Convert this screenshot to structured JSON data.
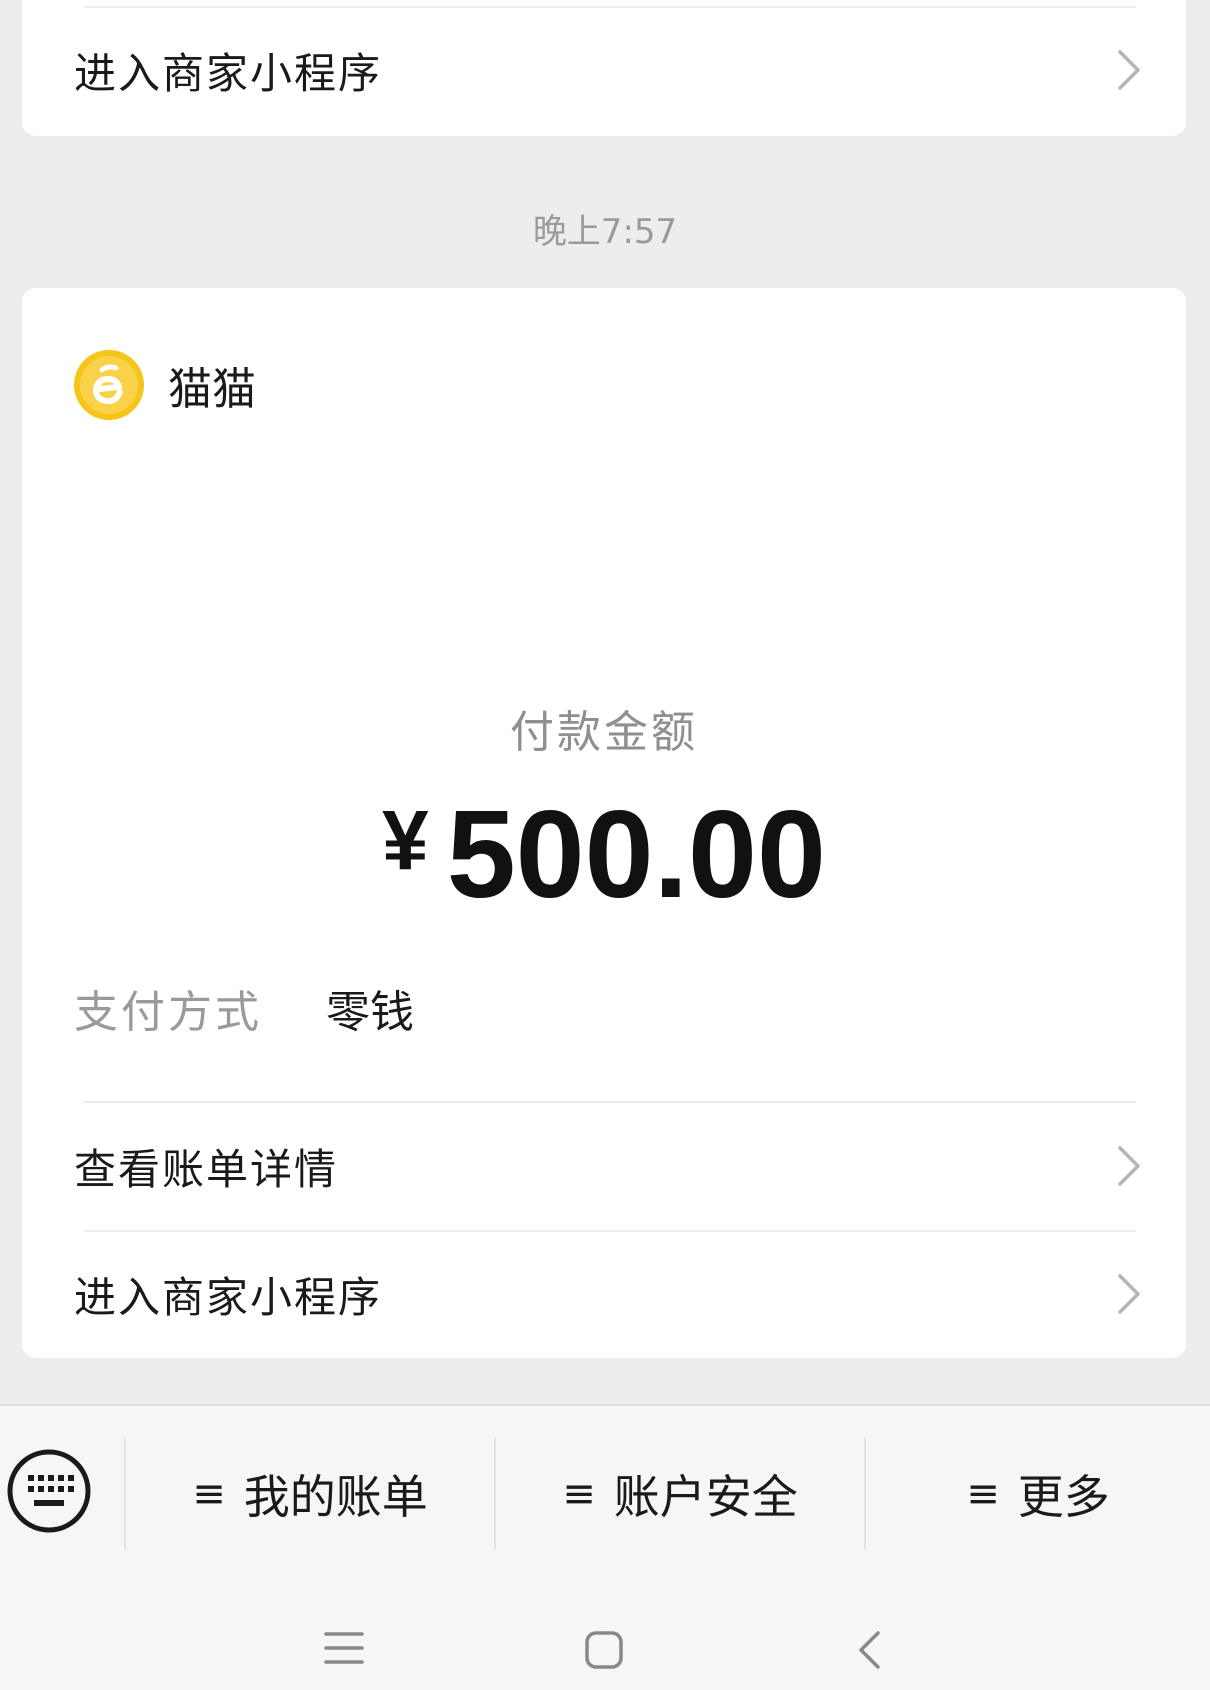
{
  "top_card": {
    "row_label": "进入商家小程序"
  },
  "timestamp": "晚上7:57",
  "merchant": {
    "name": "猫猫",
    "logo_color": "#f5c518",
    "logo_icon": "merchant-logo-icon"
  },
  "payment": {
    "amount_label": "付款金额",
    "currency_symbol": "¥",
    "amount": "500.00",
    "method_label": "支付方式",
    "method_value": "零钱"
  },
  "rows": {
    "bill_details": "查看账单详情",
    "enter_miniprogram": "进入商家小程序"
  },
  "bottom_menu": {
    "items": [
      {
        "label": "我的账单",
        "icon": "hamburger-icon"
      },
      {
        "label": "账户安全",
        "icon": "hamburger-icon"
      },
      {
        "label": "更多",
        "icon": "hamburger-icon"
      }
    ],
    "menu_glyph": "≡",
    "keyboard_icon": "keyboard-icon"
  },
  "nav_bar": {
    "icons": [
      "recent-apps-icon",
      "home-icon",
      "back-icon"
    ]
  }
}
